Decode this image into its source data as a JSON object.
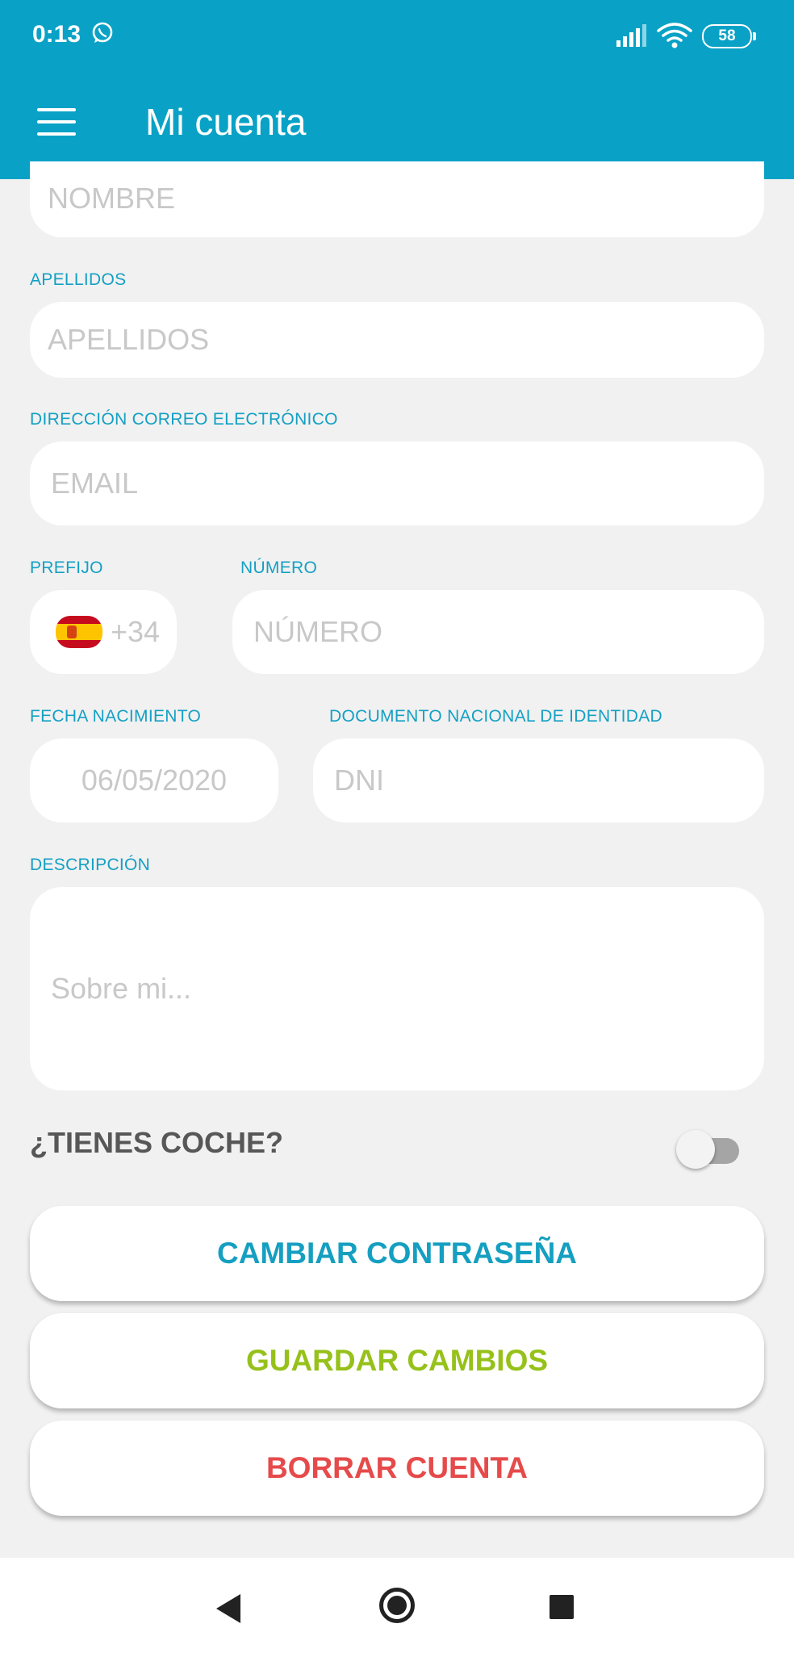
{
  "status": {
    "time": "0:13",
    "battery": "58"
  },
  "header": {
    "title": "Mi cuenta"
  },
  "form": {
    "nombre_placeholder": "NOMBRE",
    "apellidos_label": "APELLIDOS",
    "apellidos_placeholder": "APELLIDOS",
    "email_label": "DIRECCIÓN CORREO ELECTRÓNICO",
    "email_placeholder": "EMAIL",
    "prefijo_label": "PREFIJO",
    "prefijo_value": "+34",
    "numero_label": "NÚMERO",
    "numero_placeholder": "NÚMERO",
    "fecha_label": "FECHA NACIMIENTO",
    "fecha_value": "06/05/2020",
    "dni_label": "DOCUMENTO NACIONAL DE IDENTIDAD",
    "dni_placeholder": "DNI",
    "descripcion_label": "DESCRIPCIÓN",
    "descripcion_placeholder": "Sobre mi...",
    "coche_label": "¿TIENES COCHE?",
    "coche_toggle_on": false
  },
  "actions": {
    "cambiar": "CAMBIAR CONTRASEÑA",
    "guardar": "GUARDAR CAMBIOS",
    "borrar": "BORRAR CUENTA"
  },
  "colors": {
    "primary": "#09a2c6",
    "cambiar": "#159fc1",
    "guardar": "#96c11a",
    "borrar": "#e64a4a"
  }
}
